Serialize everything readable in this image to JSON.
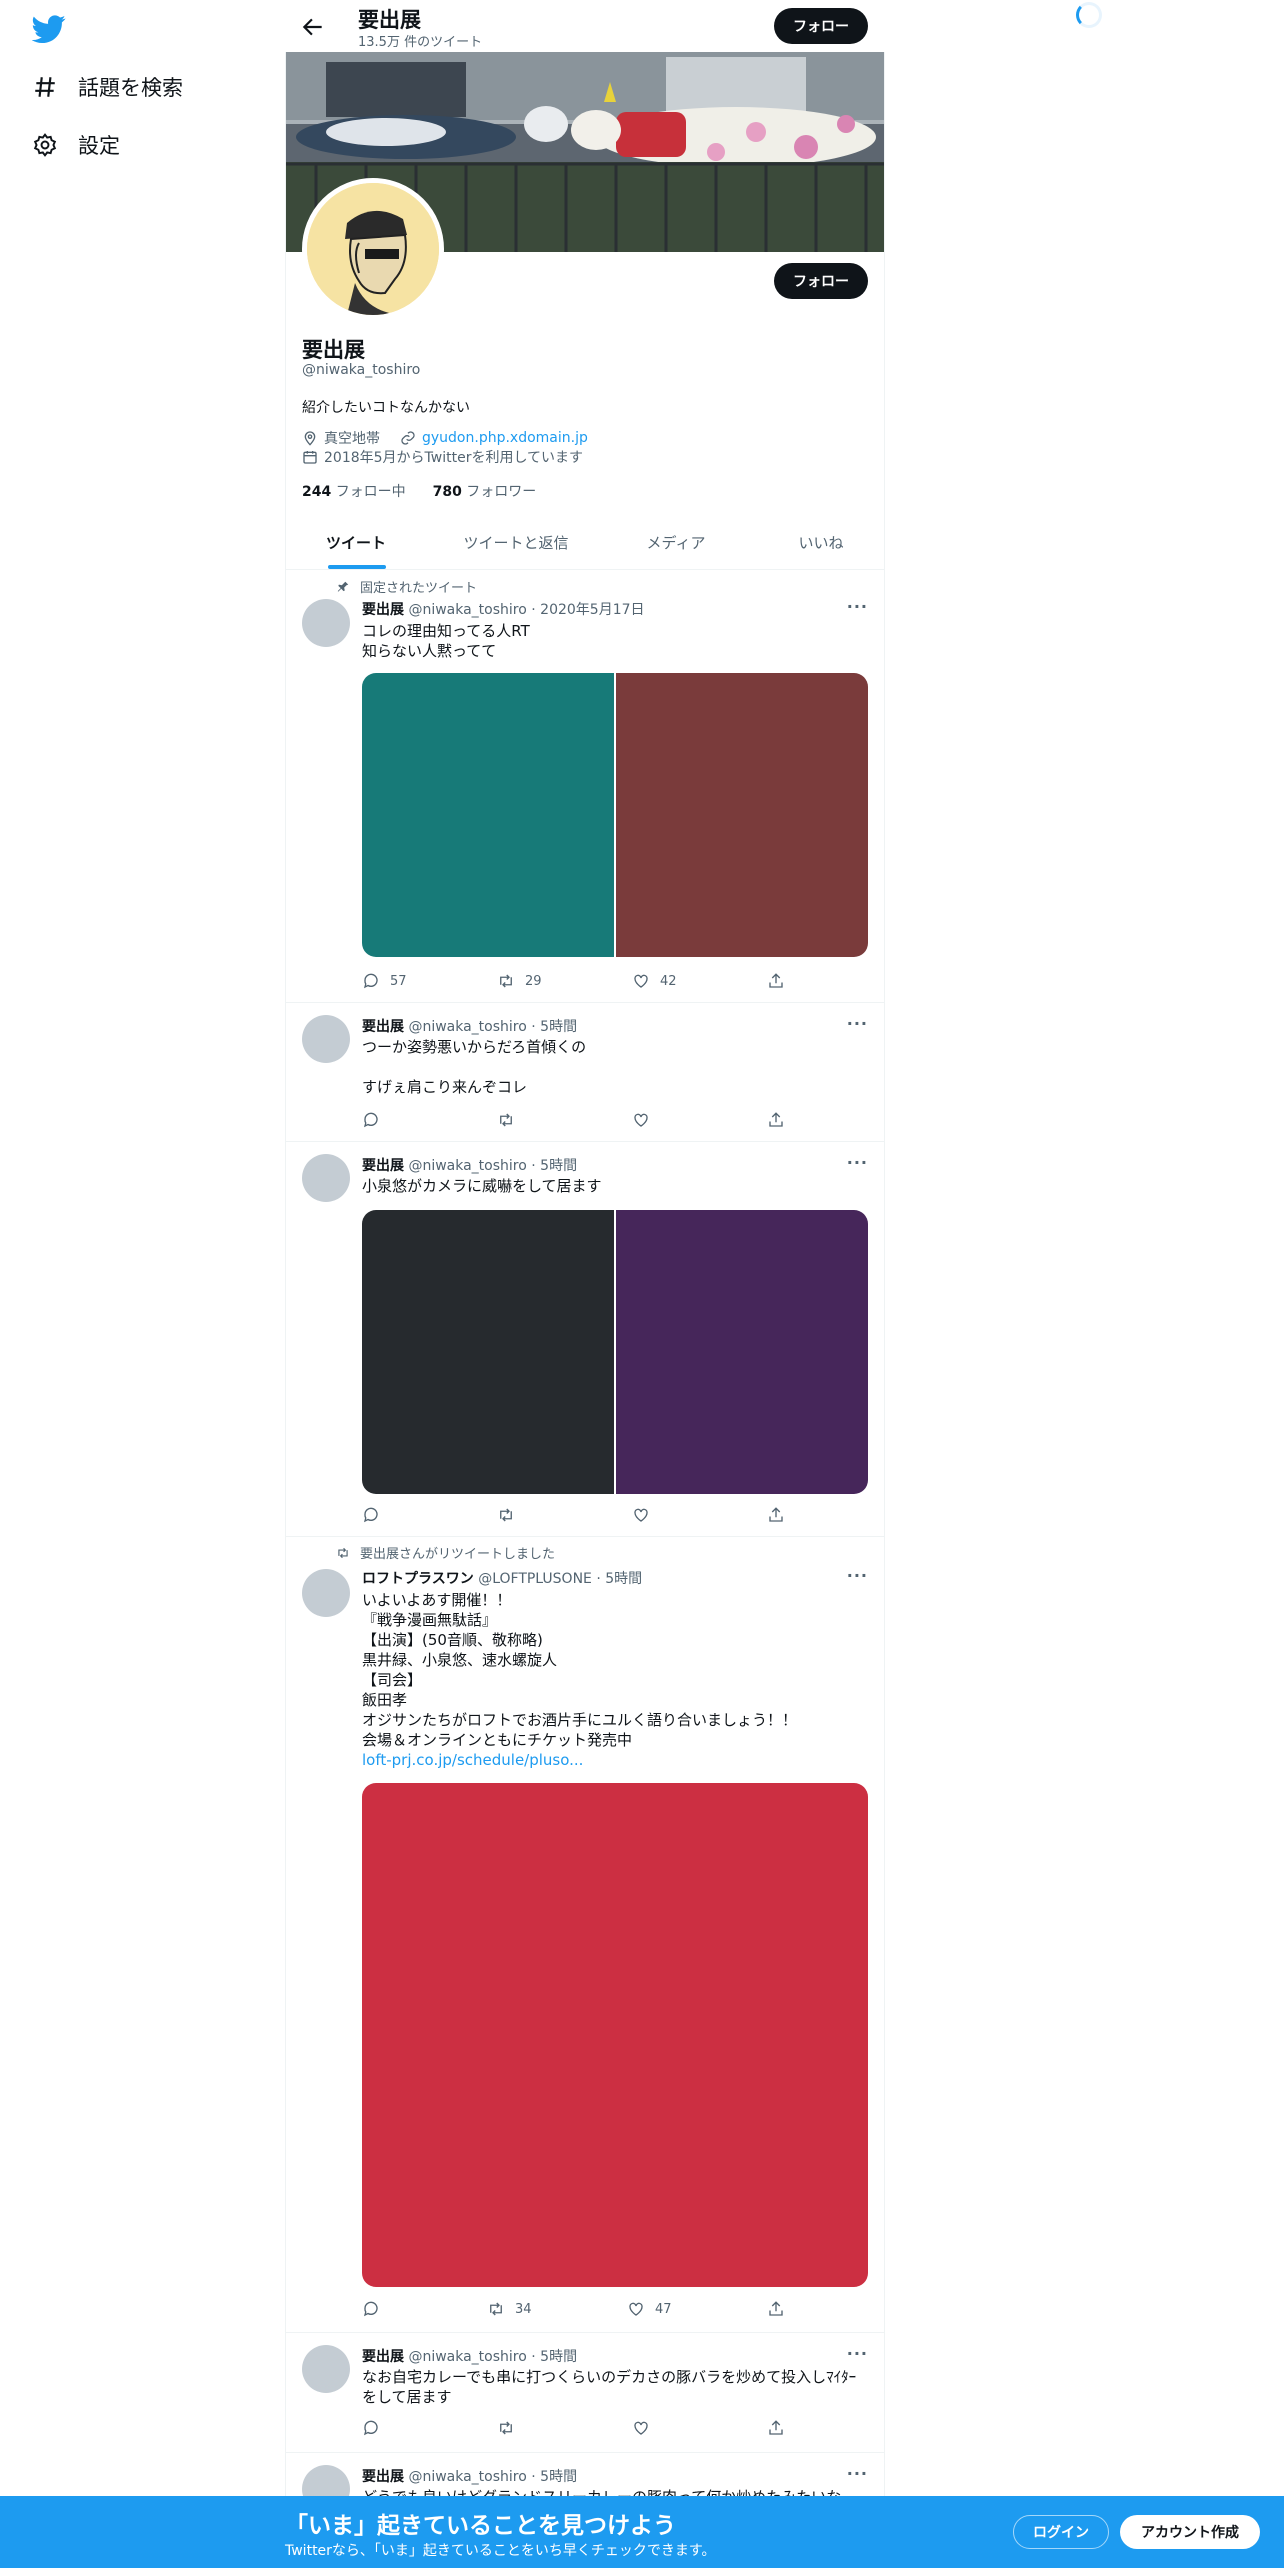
{
  "sidebar": {
    "items": [
      {
        "icon": "hashtag-icon",
        "label": "話題を検索"
      },
      {
        "icon": "gear-icon",
        "label": "設定"
      }
    ]
  },
  "header": {
    "title": "要出展",
    "subtitle": "13.5万 件のツイート",
    "follow_label": "フォロー"
  },
  "profile": {
    "name": "要出展",
    "handle": "@niwaka_toshiro",
    "bio": "紹介したいコトなんかない",
    "location": "真空地帯",
    "website": "gyudon.php.xdomain.jp",
    "joined": "2018年5月からTwitterを利用しています",
    "following_count": "244",
    "following_label": "フォロー中",
    "followers_count": "780",
    "followers_label": "フォロワー",
    "follow_label": "フォロー"
  },
  "tabs": [
    {
      "label": "ツイート",
      "active": true
    },
    {
      "label": "ツイートと返信",
      "active": false
    },
    {
      "label": "メディア",
      "active": false
    },
    {
      "label": "いいね",
      "active": false
    }
  ],
  "tweets": [
    {
      "context": "固定されたツイート",
      "name": "要出展",
      "meta": "@niwaka_toshiro · 2020年5月17日",
      "text": "コレの理由知ってる人RT\n知らない人黙ってて",
      "media_colors": [
        "#177a78",
        "#7a3b3b"
      ],
      "replies": "57",
      "retweets": "29",
      "likes": "42"
    },
    {
      "name": "要出展",
      "meta": "@niwaka_toshiro · 5時間",
      "text": "つーか姿勢悪いからだろ首傾くの\n\nすげぇ肩こり来んぞコレ",
      "replies": "",
      "retweets": "",
      "likes": ""
    },
    {
      "name": "要出展",
      "meta": "@niwaka_toshiro · 5時間",
      "text": "小泉悠がカメラに威嚇をして居ます",
      "media_colors": [
        "#262a2e",
        "#46265a"
      ],
      "replies": "",
      "retweets": "",
      "likes": ""
    },
    {
      "context": "要出展さんがリツイートしました",
      "name": "ロフトプラスワン",
      "meta": "@LOFTPLUSONE · 5時間",
      "text": "いよいよあす開催！！\n『戦争漫画無駄話』\n【出演】(50音順、敬称略)\n黒井緑、小泉悠、速水螺旋人\n【司会】\n飯田孝\nオジサンたちがロフトでお酒片手にユルく語り合いましょう！！\n会場＆オンラインともにチケット発売中",
      "link": "loft-prj.co.jp/schedule/pluso...",
      "media_colors": [
        "#cc2f42"
      ],
      "replies": "",
      "retweets": "34",
      "likes": "47"
    },
    {
      "name": "要出展",
      "meta": "@niwaka_toshiro · 5時間",
      "text": "なお自宅カレーでも串に打つくらいのデカさの豚バラを炒めて投入しﾏｲﾀｰ\nをして居ます",
      "replies": "",
      "retweets": "",
      "likes": ""
    },
    {
      "name": "要出展",
      "meta": "@niwaka_toshiro · 5時間",
      "text": "どうでも良いけどグランドスリーカレーの豚肉って何か炒めたみたいな…",
      "replies": "",
      "retweets": "",
      "likes": ""
    }
  ],
  "bottom_bar": {
    "title": "「いま」起きていることを見つけよう",
    "subtitle": "Twitterなら、「いま」起きていることをいち早くチェックできます。",
    "login_label": "ログイン",
    "signup_label": "アカウント作成"
  },
  "colors": {
    "accent": "#1d9bf0",
    "dark": "#0f1419"
  }
}
